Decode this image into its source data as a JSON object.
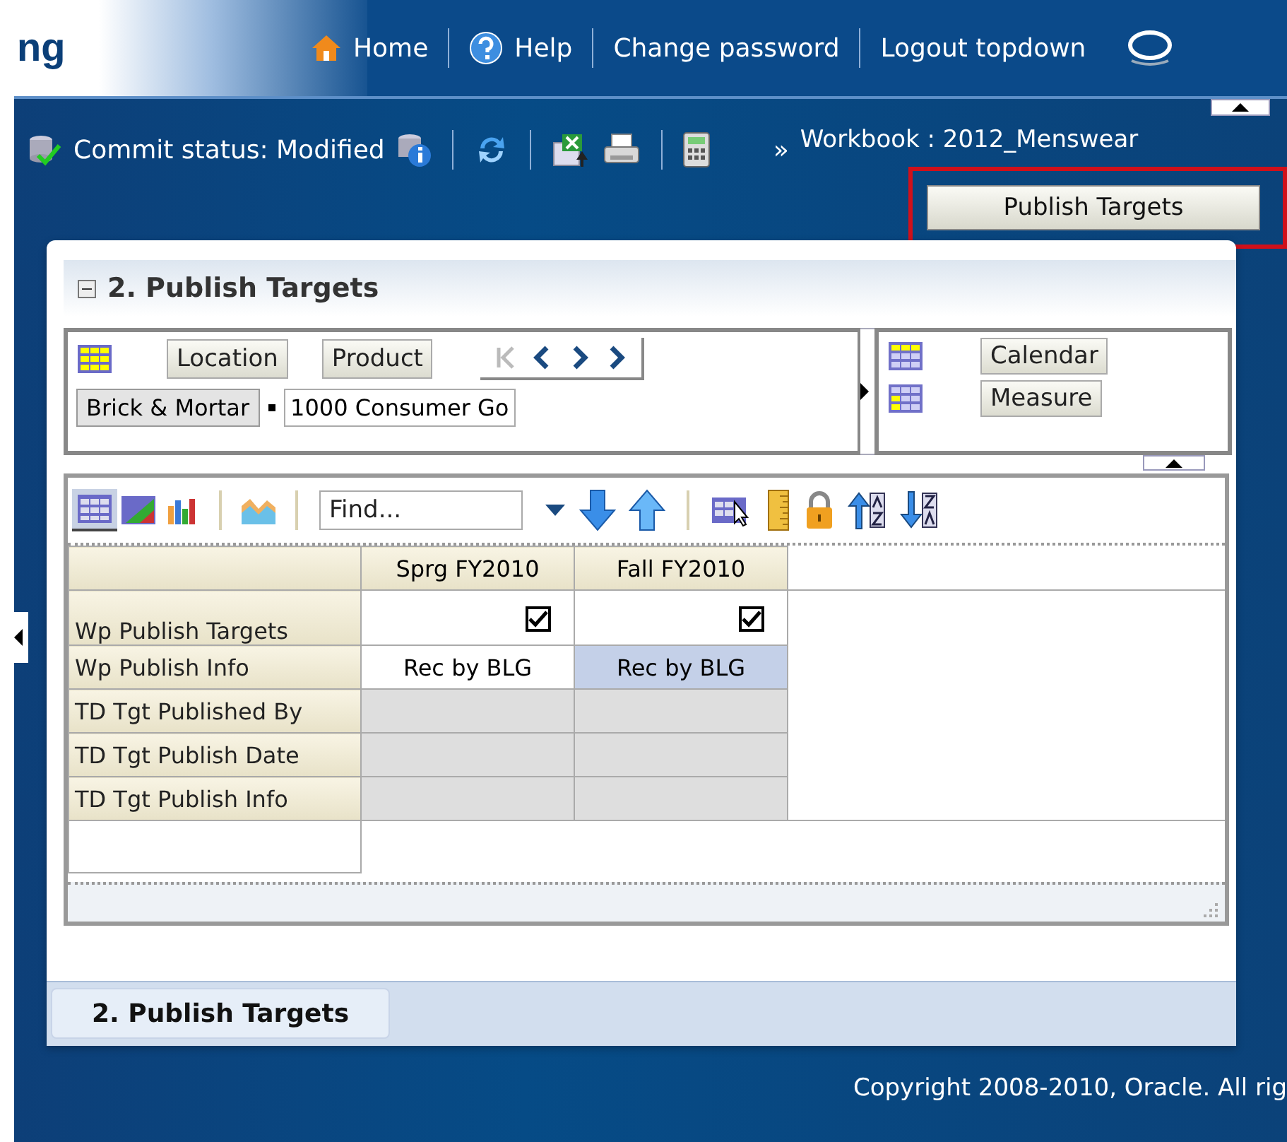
{
  "header": {
    "logo_text": "ng",
    "links": [
      {
        "kind": "home",
        "label": "Home"
      },
      {
        "kind": "help",
        "label": "Help"
      },
      {
        "kind": "plain",
        "label": "Change password"
      },
      {
        "kind": "plain",
        "label": "Logout topdown"
      }
    ]
  },
  "toolbar": {
    "commit_status": "Commit status: Modified",
    "chevron": "»",
    "workbook": "Workbook : 2012_Menswear"
  },
  "publish_button": {
    "label": "Publish Targets",
    "highlighted": true
  },
  "panel": {
    "title": "2. Publish Targets",
    "expanded": true,
    "row_dimensions": [
      "Location",
      "Product"
    ],
    "navigation": [
      {
        "kind": "first",
        "disabled": true
      },
      {
        "kind": "prev",
        "disabled": false
      },
      {
        "kind": "next",
        "disabled": false
      },
      {
        "kind": "last",
        "disabled": false
      }
    ],
    "row_values": [
      "Brick & Mortar",
      "1000 Consumer Go"
    ],
    "column_dimensions": [
      "Calendar",
      "Measure"
    ],
    "views": [
      {
        "kind": "grid",
        "selected": true
      },
      {
        "kind": "grid-chart",
        "selected": false
      },
      {
        "kind": "bar-chart",
        "selected": false
      },
      {
        "kind": "area-chart",
        "selected": false
      }
    ],
    "find": {
      "placeholder": "Find..."
    },
    "grid": {
      "columns": [
        "Sprg FY2010",
        "Fall FY2010"
      ],
      "rows": [
        {
          "label": "Wp Publish Targets",
          "kind": "checkbox",
          "cells": [
            {
              "checked": true
            },
            {
              "checked": true
            }
          ]
        },
        {
          "label": "Wp Publish Info",
          "kind": "text",
          "cells": [
            {
              "value": "Rec by BLG",
              "selected": false
            },
            {
              "value": "Rec by BLG",
              "selected": true
            }
          ]
        },
        {
          "label": "TD Tgt Published By",
          "kind": "readonly",
          "cells": [
            {},
            {}
          ]
        },
        {
          "label": "TD Tgt Publish Date",
          "kind": "readonly",
          "cells": [
            {},
            {}
          ]
        },
        {
          "label": "TD Tgt Publish Info",
          "kind": "readonly",
          "cells": [
            {},
            {}
          ]
        }
      ]
    }
  },
  "tabs": [
    {
      "label": "2. Publish Targets",
      "selected": true
    }
  ],
  "copyright": "Copyright 2008-2010, Oracle. All rig"
}
